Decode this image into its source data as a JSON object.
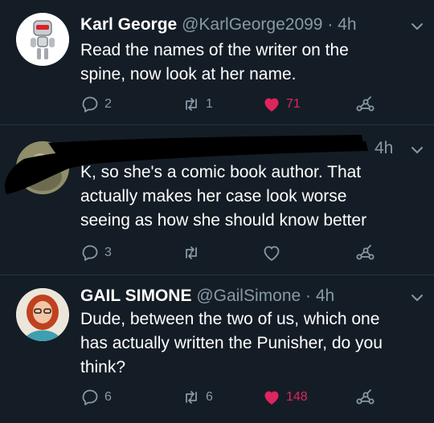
{
  "colors": {
    "background": "#141d26",
    "muted": "#8899a6",
    "like_active": "#e0245e",
    "text": "#ffffff"
  },
  "tweets": [
    {
      "display_name": "Karl George",
      "handle": "@KarlGeorge2099",
      "time": "· 4h",
      "text_lines": [
        "Read the names of the writer on the",
        "spine, now look at her name."
      ],
      "avatar_icon": "robot-avatar",
      "replies": "2",
      "retweets": "1",
      "likes": "71",
      "liked": true
    },
    {
      "display_name": "",
      "handle": "",
      "time": "4h",
      "redacted": true,
      "text_lines": [
        "K, so she's a comic book author. That",
        "actually makes her case look worse",
        "seeing as how she should know better"
      ],
      "replies": "3",
      "retweets": "",
      "likes": "",
      "liked": false
    },
    {
      "display_name": "GAIL SIMONE",
      "handle": "@GailSimone",
      "time": "· 4h",
      "text_lines": [
        "Dude, between the two of us, which one",
        "has actually written the Punisher, do you",
        "think?"
      ],
      "avatar_icon": "person-avatar",
      "replies": "6",
      "retweets": "6",
      "likes": "148",
      "liked": true
    }
  ]
}
